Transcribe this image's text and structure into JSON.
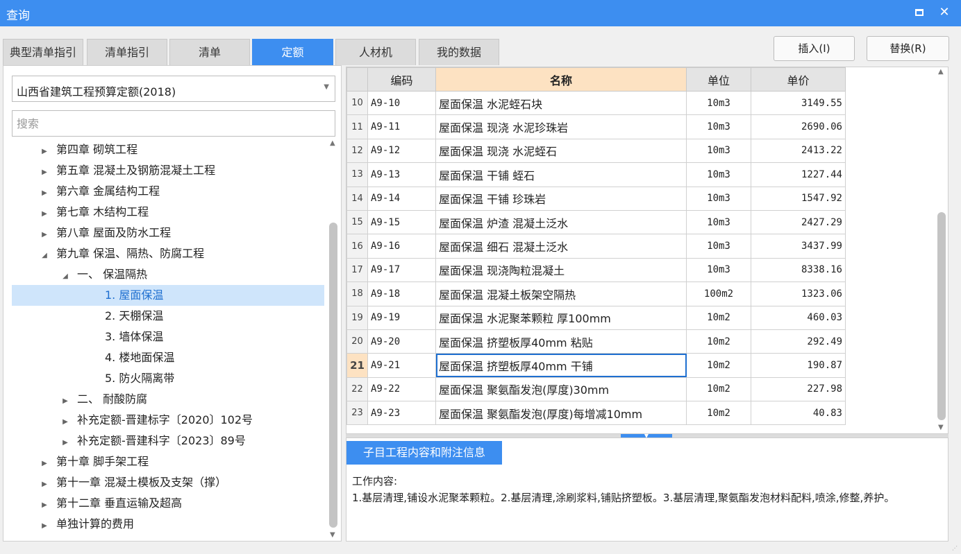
{
  "window": {
    "title": "查询"
  },
  "tabs": [
    {
      "label": "典型清单指引",
      "active": false
    },
    {
      "label": "清单指引",
      "active": false
    },
    {
      "label": "清单",
      "active": false
    },
    {
      "label": "定额",
      "active": true
    },
    {
      "label": "人材机",
      "active": false
    },
    {
      "label": "我的数据",
      "active": false
    }
  ],
  "toolbar": {
    "insert_label": "插入(I)",
    "replace_label": "替换(R)"
  },
  "library": {
    "selected": "山西省建筑工程预算定额(2018)"
  },
  "search": {
    "placeholder": "搜索",
    "value": ""
  },
  "tree": [
    {
      "label": "第四章 砌筑工程",
      "level": 0,
      "expanded": false,
      "selected": false
    },
    {
      "label": "第五章 混凝土及钢筋混凝土工程",
      "level": 0,
      "expanded": false,
      "selected": false
    },
    {
      "label": "第六章 金属结构工程",
      "level": 0,
      "expanded": false,
      "selected": false
    },
    {
      "label": "第七章 木结构工程",
      "level": 0,
      "expanded": false,
      "selected": false
    },
    {
      "label": "第八章 屋面及防水工程",
      "level": 0,
      "expanded": false,
      "selected": false
    },
    {
      "label": "第九章 保温、隔热、防腐工程",
      "level": 0,
      "expanded": true,
      "selected": false
    },
    {
      "label": "一、 保温隔热",
      "level": 1,
      "expanded": true,
      "selected": false
    },
    {
      "label": "1. 屋面保温",
      "level": 2,
      "leaf": true,
      "selected": true
    },
    {
      "label": "2. 天棚保温",
      "level": 2,
      "leaf": true,
      "selected": false
    },
    {
      "label": "3. 墙体保温",
      "level": 2,
      "leaf": true,
      "selected": false
    },
    {
      "label": "4. 楼地面保温",
      "level": 2,
      "leaf": true,
      "selected": false
    },
    {
      "label": "5. 防火隔离带",
      "level": 2,
      "leaf": true,
      "selected": false
    },
    {
      "label": "二、 耐酸防腐",
      "level": 1,
      "expanded": false,
      "selected": false
    },
    {
      "label": "补充定额-晋建标字〔2020〕102号",
      "level": 1,
      "expanded": false,
      "selected": false
    },
    {
      "label": "补充定额-晋建科字〔2023〕89号",
      "level": 1,
      "expanded": false,
      "selected": false
    },
    {
      "label": "第十章 脚手架工程",
      "level": 0,
      "expanded": false,
      "selected": false
    },
    {
      "label": "第十一章 混凝土模板及支架（撑）",
      "level": 0,
      "expanded": false,
      "selected": false
    },
    {
      "label": "第十二章 垂直运输及超高",
      "level": 0,
      "expanded": false,
      "selected": false
    },
    {
      "label": "单独计算的费用",
      "level": 0,
      "expanded": false,
      "selected": false
    }
  ],
  "grid": {
    "columns": [
      "编码",
      "名称",
      "单位",
      "单价"
    ],
    "current_row": "21",
    "rows": [
      {
        "no": "10",
        "code": "A9-10",
        "name": "屋面保温 水泥蛭石块",
        "unit": "10m3",
        "price": "3149.55"
      },
      {
        "no": "11",
        "code": "A9-11",
        "name": "屋面保温 现浇 水泥珍珠岩",
        "unit": "10m3",
        "price": "2690.06"
      },
      {
        "no": "12",
        "code": "A9-12",
        "name": "屋面保温 现浇 水泥蛭石",
        "unit": "10m3",
        "price": "2413.22"
      },
      {
        "no": "13",
        "code": "A9-13",
        "name": "屋面保温 干铺 蛭石",
        "unit": "10m3",
        "price": "1227.44"
      },
      {
        "no": "14",
        "code": "A9-14",
        "name": "屋面保温 干铺 珍珠岩",
        "unit": "10m3",
        "price": "1547.92"
      },
      {
        "no": "15",
        "code": "A9-15",
        "name": "屋面保温 炉渣 混凝土泛水",
        "unit": "10m3",
        "price": "2427.29"
      },
      {
        "no": "16",
        "code": "A9-16",
        "name": "屋面保温 细石 混凝土泛水",
        "unit": "10m3",
        "price": "3437.99"
      },
      {
        "no": "17",
        "code": "A9-17",
        "name": "屋面保温 现浇陶粒混凝土",
        "unit": "10m3",
        "price": "8338.16"
      },
      {
        "no": "18",
        "code": "A9-18",
        "name": "屋面保温 混凝土板架空隔热",
        "unit": "100m2",
        "price": "1323.06"
      },
      {
        "no": "19",
        "code": "A9-19",
        "name": "屋面保温 水泥聚苯颗粒 厚100mm",
        "unit": "10m2",
        "price": "460.03"
      },
      {
        "no": "20",
        "code": "A9-20",
        "name": "屋面保温 挤塑板厚40mm 粘贴",
        "unit": "10m2",
        "price": "292.49"
      },
      {
        "no": "21",
        "code": "A9-21",
        "name": "屋面保温 挤塑板厚40mm 干铺",
        "unit": "10m2",
        "price": "190.87"
      },
      {
        "no": "22",
        "code": "A9-22",
        "name": "屋面保温 聚氨酯发泡(厚度)30mm",
        "unit": "10m2",
        "price": "227.98"
      },
      {
        "no": "23",
        "code": "A9-23",
        "name": "屋面保温 聚氨酯发泡(厚度)每增减10mm",
        "unit": "10m2",
        "price": "40.83"
      }
    ]
  },
  "info": {
    "tab_label": "子目工程内容和附注信息",
    "heading": "工作内容:",
    "body": "1.基层清理,铺设水泥聚苯颗粒。2.基层清理,涂刷浆料,铺贴挤塑板。3.基层清理,聚氨酯发泡材料配料,喷涂,修整,养护。"
  }
}
